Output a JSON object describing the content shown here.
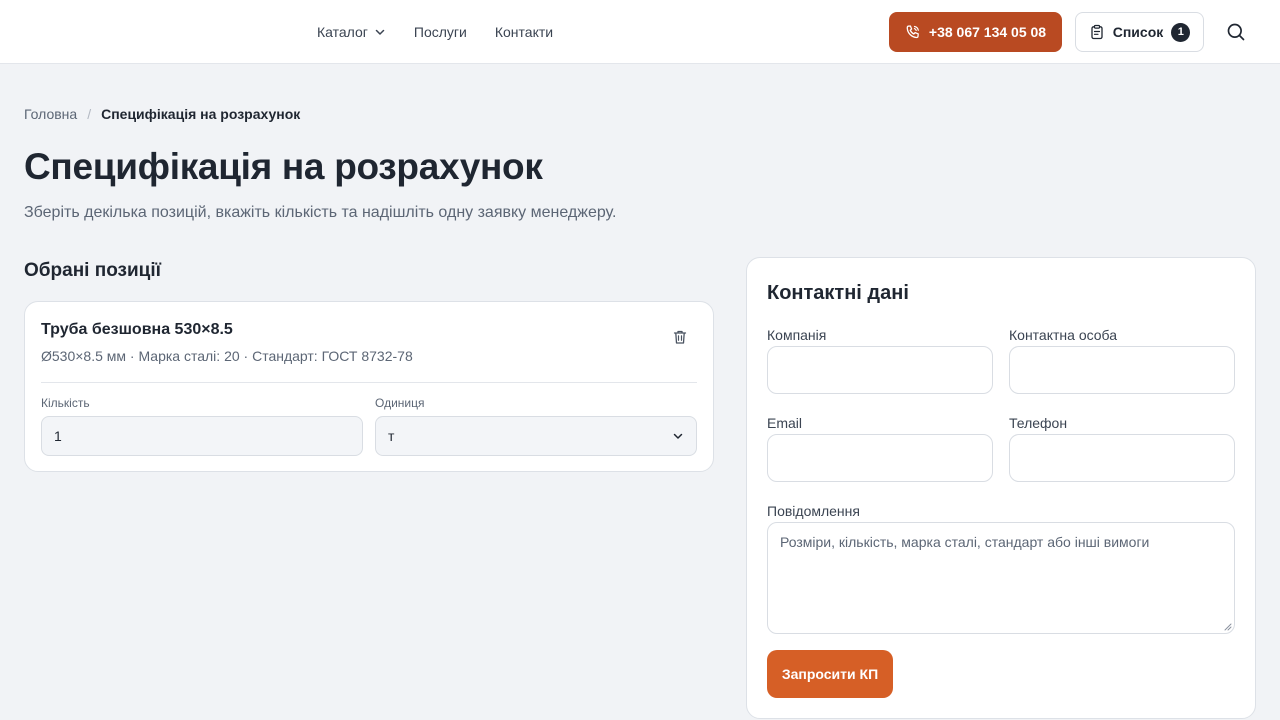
{
  "header": {
    "nav": [
      {
        "label": "Каталог",
        "has_dropdown": true
      },
      {
        "label": "Послуги"
      },
      {
        "label": "Контакти"
      }
    ],
    "phone_label": "+38 067 134 05 08",
    "list_label": "Список",
    "list_count": "1",
    "accent_color": "#b94a22"
  },
  "breadcrumb": {
    "home": "Головна",
    "separator": "/",
    "current": "Специфікація на розрахунок"
  },
  "page": {
    "title": "Специфікація на розрахунок",
    "subtitle": "Зберіть декілька позицій, вкажіть кількість та надішліть одну заявку менеджеру."
  },
  "selected": {
    "title": "Обрані позиції",
    "items": [
      {
        "name": "Труба безшовна 530×8.5",
        "meta": "Ø530×8.5 мм · Марка сталі: 20 · Стандарт: ГОСТ 8732-78",
        "qty_label": "Кількість",
        "qty_value": "1",
        "unit_label": "Одиниця",
        "unit_value": "т"
      }
    ]
  },
  "contact": {
    "title": "Контактні дані",
    "company_label": "Компанія",
    "company_value": "",
    "person_label": "Контактна особа",
    "person_value": "",
    "email_label": "Email",
    "email_value": "",
    "phone_label": "Телефон",
    "phone_value": "",
    "message_label": "Повідомлення",
    "message_placeholder": "Розміри, кількість, марка сталі, стандарт або інші вимоги",
    "submit_label": "Запросити КП",
    "submit_color": "#d65f26"
  }
}
